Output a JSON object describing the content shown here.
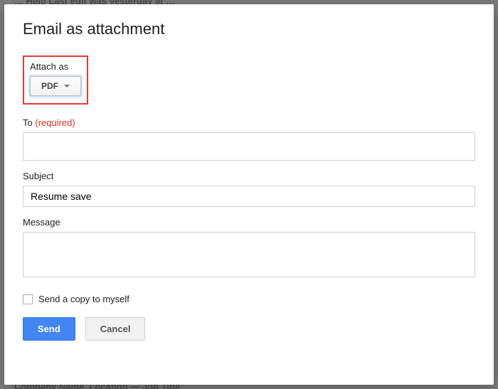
{
  "background": {
    "top_snippet": "…  Help    Last edit was yesterday at …",
    "bottom_snippet": "Company Name, Location  — Job Title"
  },
  "dialog": {
    "title": "Email as attachment",
    "attach_section": {
      "label": "Attach as",
      "dropdown_value": "PDF"
    },
    "to_field": {
      "label": "To",
      "required_text": "(required)",
      "value": ""
    },
    "subject_field": {
      "label": "Subject",
      "value": "Resume save"
    },
    "message_field": {
      "label": "Message",
      "value": ""
    },
    "copy_self": {
      "label": "Send a copy to myself",
      "checked": false
    },
    "buttons": {
      "send": "Send",
      "cancel": "Cancel"
    }
  }
}
